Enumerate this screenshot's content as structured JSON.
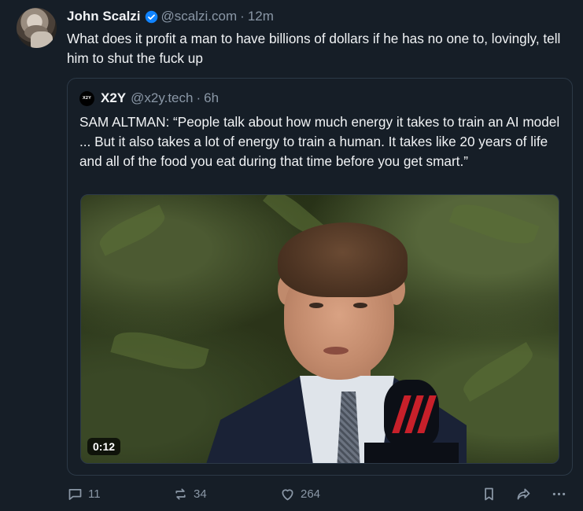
{
  "post": {
    "author_name": "John Scalzi",
    "author_handle": "@scalzi.com",
    "separator": "·",
    "time": "12m",
    "text": "What does it profit a man to have billions of dollars if he has no one to, lovingly, tell him to shut the fuck up"
  },
  "quote": {
    "logo_text": "X2Y",
    "author_name": "X2Y",
    "author_handle": "@x2y.tech",
    "separator": "·",
    "time": "6h",
    "text": "SAM ALTMAN: “People talk about how much energy it takes to train an AI model ... But it also takes a lot of energy to train a human. It takes like 20 years of life and all of the food you eat during that time before you get smart.”",
    "video": {
      "duration": "0:12"
    }
  },
  "actions": {
    "reply_count": "11",
    "repost_count": "34",
    "like_count": "264"
  },
  "icons": {
    "verified": "verified-badge-icon",
    "reply": "reply-icon",
    "repost": "repost-icon",
    "like": "heart-icon",
    "bookmark": "bookmark-icon",
    "share": "share-icon",
    "more": "more-icon"
  },
  "colors": {
    "background": "#161e27",
    "text": "#f1f3f5",
    "muted": "#8a97a6",
    "verified": "#1083fe",
    "border": "#2c3947"
  }
}
